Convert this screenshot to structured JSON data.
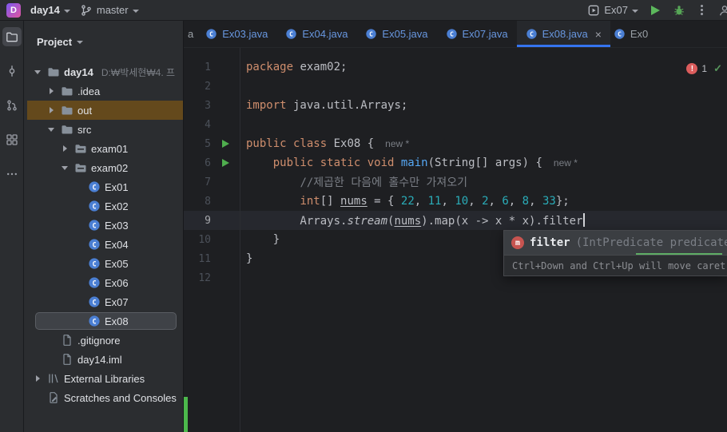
{
  "colors": {
    "accent_blue": "#3574f0",
    "editor_bg": "#1e1f22",
    "panel_bg": "#2b2d30",
    "keyword_orange": "#cf8e6d",
    "plain_text": "#bcbec4",
    "comment_gray": "#7a7e85",
    "number_teal": "#2aacb8",
    "method_blue": "#56a8f5",
    "run_green": "#4fae4e",
    "error_red": "#db5c5c",
    "ok_green": "#57965c",
    "modified_tab_blue": "#6897e0",
    "out_highlight": "#64491c"
  },
  "titlebar": {
    "app_letter": "D",
    "project_name": "day14",
    "branch_name": "master",
    "run_config_name": "Ex07"
  },
  "tool_stripe": {
    "items": [
      {
        "icon": "project-folder",
        "active": true
      },
      {
        "icon": "commit"
      },
      {
        "icon": "pull-request"
      },
      {
        "icon": "structure"
      },
      {
        "icon": "more"
      }
    ]
  },
  "project_panel": {
    "header": "Project",
    "items": [
      {
        "label": "day14",
        "icon": "folder",
        "chevron": "down",
        "indent": 0,
        "bold": true,
        "path_hint": "D:₩박세현₩4. 프"
      },
      {
        "label": ".idea",
        "icon": "folder",
        "chevron": "right",
        "indent": 1
      },
      {
        "label": "out",
        "icon": "folder",
        "chevron": "right",
        "indent": 1,
        "highlight": "amber"
      },
      {
        "label": "src",
        "icon": "folder",
        "chevron": "down",
        "indent": 1
      },
      {
        "label": "exam01",
        "icon": "package",
        "chevron": "right",
        "indent": 2
      },
      {
        "label": "exam02",
        "icon": "package",
        "chevron": "down",
        "indent": 2
      },
      {
        "label": "Ex01",
        "icon": "class",
        "indent": 3
      },
      {
        "label": "Ex02",
        "icon": "class",
        "indent": 3
      },
      {
        "label": "Ex03",
        "icon": "class",
        "indent": 3
      },
      {
        "label": "Ex04",
        "icon": "class",
        "indent": 3
      },
      {
        "label": "Ex05",
        "icon": "class",
        "indent": 3
      },
      {
        "label": "Ex06",
        "icon": "class",
        "indent": 3
      },
      {
        "label": "Ex07",
        "icon": "class",
        "indent": 3
      },
      {
        "label": "Ex08",
        "icon": "class",
        "indent": 3,
        "selected": true
      },
      {
        "label": ".gitignore",
        "icon": "file",
        "indent": 1
      },
      {
        "label": "day14.iml",
        "icon": "file",
        "indent": 1
      },
      {
        "label": "External Libraries",
        "icon": "library",
        "chevron": "right",
        "indent": 0
      },
      {
        "label": "Scratches and Consoles",
        "icon": "scratch",
        "indent": 0
      }
    ]
  },
  "tabs": [
    {
      "label": "a",
      "partial": true
    },
    {
      "label": "Ex03.java",
      "icon": "class"
    },
    {
      "label": "Ex04.java",
      "icon": "class"
    },
    {
      "label": "Ex05.java",
      "icon": "class"
    },
    {
      "label": "Ex07.java",
      "icon": "class"
    },
    {
      "label": "Ex08.java",
      "icon": "class",
      "active": true,
      "close": "×"
    },
    {
      "label": "Ex0",
      "icon": "class",
      "partial": true
    }
  ],
  "editor": {
    "inspections": {
      "error_mark": "!",
      "error_count": "1",
      "ok_mark": "✓"
    },
    "lines": [
      {
        "num": "1",
        "tokens": [
          {
            "t": "package",
            "s": "k"
          },
          {
            "t": " exam02;",
            "s": "p"
          }
        ]
      },
      {
        "num": "2",
        "tokens": []
      },
      {
        "num": "3",
        "tokens": [
          {
            "t": "import",
            "s": "k"
          },
          {
            "t": " java.util.Arrays;",
            "s": "p"
          }
        ]
      },
      {
        "num": "4",
        "tokens": []
      },
      {
        "num": "5",
        "run": true,
        "inlay": "new *",
        "tokens": [
          {
            "t": "public class",
            "s": "k"
          },
          {
            "t": " Ex08 {",
            "s": "p"
          }
        ]
      },
      {
        "num": "6",
        "run": true,
        "inlay": "new *",
        "tokens": [
          {
            "t": "    ",
            "s": "p"
          },
          {
            "t": "public static void",
            "s": "k"
          },
          {
            "t": " ",
            "s": "p"
          },
          {
            "t": "main",
            "s": "m"
          },
          {
            "t": "(String[] args) {",
            "s": "p"
          }
        ]
      },
      {
        "num": "7",
        "tokens": [
          {
            "t": "        ",
            "s": "p"
          },
          {
            "t": "//제곱한 다음에 홀수만 가져오기",
            "s": "c"
          }
        ]
      },
      {
        "num": "8",
        "tokens": [
          {
            "t": "        ",
            "s": "p"
          },
          {
            "t": "int",
            "s": "k"
          },
          {
            "t": "[] ",
            "s": "p"
          },
          {
            "t": "nums",
            "s": "u"
          },
          {
            "t": " = { ",
            "s": "p"
          },
          {
            "t": "22",
            "s": "n"
          },
          {
            "t": ", ",
            "s": "p"
          },
          {
            "t": "11",
            "s": "n"
          },
          {
            "t": ", ",
            "s": "p"
          },
          {
            "t": "10",
            "s": "n"
          },
          {
            "t": ", ",
            "s": "p"
          },
          {
            "t": "2",
            "s": "n"
          },
          {
            "t": ", ",
            "s": "p"
          },
          {
            "t": "6",
            "s": "n"
          },
          {
            "t": ", ",
            "s": "p"
          },
          {
            "t": "8",
            "s": "n"
          },
          {
            "t": ", ",
            "s": "p"
          },
          {
            "t": "33",
            "s": "n"
          },
          {
            "t": "};",
            "s": "p"
          }
        ]
      },
      {
        "num": "9",
        "current": true,
        "caret": true,
        "tokens": [
          {
            "t": "        Arrays.",
            "s": "p"
          },
          {
            "t": "stream",
            "s": "i"
          },
          {
            "t": "(",
            "s": "p"
          },
          {
            "t": "nums",
            "s": "u"
          },
          {
            "t": ").map(x -> x * x).filter",
            "s": "p"
          }
        ]
      },
      {
        "num": "10",
        "tokens": [
          {
            "t": "    }",
            "s": "p"
          }
        ]
      },
      {
        "num": "11",
        "tokens": [
          {
            "t": "}",
            "s": "p"
          }
        ]
      },
      {
        "num": "12",
        "tokens": []
      }
    ]
  },
  "popup": {
    "kind_letter": "m",
    "name": "filter",
    "signature": "(IntPredicate predicate)",
    "hint": "Ctrl+Down and Ctrl+Up will move caret down and up"
  }
}
